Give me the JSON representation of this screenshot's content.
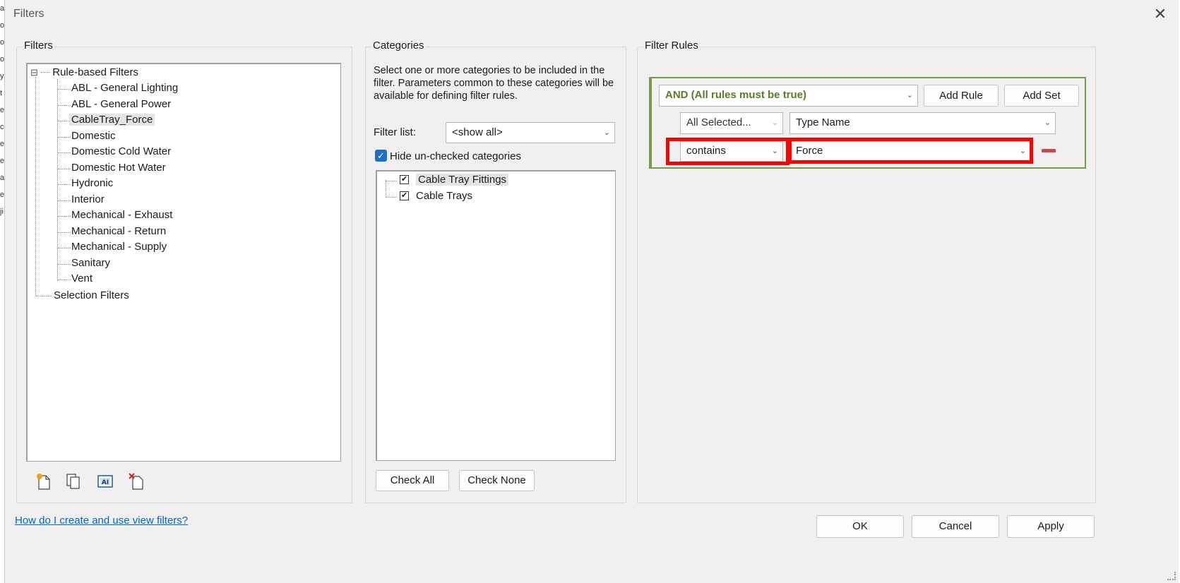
{
  "window": {
    "title": "Filters",
    "close_glyph": "✕"
  },
  "background_edge_letters": [
    "a",
    "o",
    "o",
    "o",
    "y",
    "t",
    "e",
    "c",
    "e",
    "e",
    "a",
    "e",
    "ji"
  ],
  "filters_panel": {
    "label": "Filters",
    "root_rule_based": "Rule-based Filters",
    "expand_glyph": "⊟",
    "items": [
      "ABL - General Lighting",
      "ABL - General Power",
      "CableTray_Force",
      "Domestic",
      "Domestic Cold Water",
      "Domestic Hot Water",
      "Hydronic",
      "Interior",
      "Mechanical - Exhaust",
      "Mechanical - Return",
      "Mechanical - Supply",
      "Sanitary",
      "Vent"
    ],
    "selected_item": "CableTray_Force",
    "root_selection": "Selection Filters",
    "toolbar_icons": [
      "new-filter-icon",
      "duplicate-filter-icon",
      "rename-filter-icon",
      "delete-filter-icon"
    ]
  },
  "categories_panel": {
    "label": "Categories",
    "description": "Select one or more categories to be included in the filter.  Parameters common to these categories will be available for defining filter rules.",
    "filter_list_label": "Filter list:",
    "filter_list_value": "<show all>",
    "hide_unchecked_label": "Hide un-checked categories",
    "hide_unchecked_checked": true,
    "items": [
      {
        "label": "Cable Tray Fittings",
        "checked": true,
        "selected": true
      },
      {
        "label": "Cable Trays",
        "checked": true,
        "selected": false
      }
    ],
    "check_all_label": "Check All",
    "check_none_label": "Check None"
  },
  "rules_panel": {
    "label": "Filter Rules",
    "logic_value": "AND (All rules must be true)",
    "add_rule_label": "Add Rule",
    "add_set_label": "Add Set",
    "rule": {
      "scope_value": "All Selected...",
      "parameter_value": "Type Name",
      "operator_value": "contains",
      "value_value": "Force"
    },
    "logic_color": "#5a7d2a",
    "highlight_color": "#ff0000"
  },
  "footer": {
    "help_link": "How do I create and use view filters?",
    "ok_label": "OK",
    "cancel_label": "Cancel",
    "apply_label": "Apply"
  }
}
